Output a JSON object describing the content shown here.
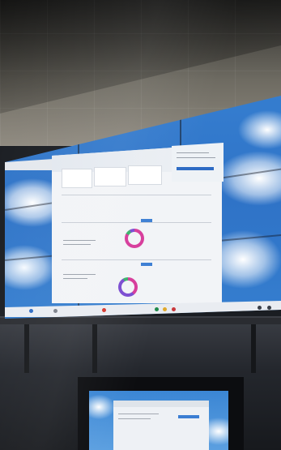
{
  "dashboard": {
    "cards": [
      {
        "title": "",
        "value": ""
      },
      {
        "title": "",
        "value": ""
      },
      {
        "title": "",
        "value": ""
      }
    ]
  },
  "colors": {
    "sky": "#3a86d6",
    "donut_magenta": "#d63a9a",
    "donut_green": "#38b26a",
    "donut_purple": "#7a4bd1",
    "taskbar": "#e9ecf1"
  },
  "icons": [
    "windows-start-icon",
    "search-icon",
    "chrome-icon",
    "edge-icon",
    "folder-icon",
    "wifi-icon",
    "volume-icon"
  ]
}
